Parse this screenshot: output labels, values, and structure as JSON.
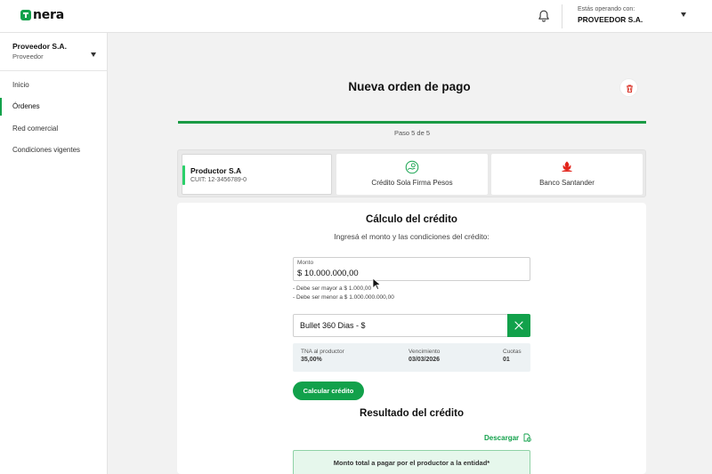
{
  "app": {
    "logo_text": "nera"
  },
  "header": {
    "operating_label": "Estás operando con:",
    "operating_value": "PROVEEDOR S.A."
  },
  "sidebar": {
    "company": "Proveedor S.A.",
    "role": "Proveedor",
    "items": [
      {
        "label": "Inicio",
        "active": false
      },
      {
        "label": "Órdenes",
        "active": true
      },
      {
        "label": "Red comercial",
        "active": false
      },
      {
        "label": "Condiciones vigentes",
        "active": false
      }
    ]
  },
  "page": {
    "title": "Nueva orden de pago",
    "step_text": "Paso 5 de 5",
    "progress_fraction": 1.0
  },
  "summary_cards": {
    "producer": {
      "name": "Productor S.A",
      "cuit": "CUIT: 12-3456789-0"
    },
    "product": {
      "label": "Crédito Sola Firma Pesos",
      "icon": "hand-coin-icon"
    },
    "bank": {
      "label": "Banco Santander",
      "icon": "santander-flame-icon"
    }
  },
  "calculation": {
    "title": "Cálculo del crédito",
    "subtitle": "Ingresá el monto y las condiciones del crédito:",
    "amount_label": "Monto",
    "amount_value": "$ 10.000.000,00",
    "hint_min": "- Debe ser mayor a $ 1.000,00",
    "hint_max": "- Debe ser menor a $ 1.000.000.000,00",
    "plan_value": "Bullet 360 Dias - $",
    "conditions": {
      "tna_label": "TNA al productor",
      "tna_value": "35,00%",
      "due_label": "Vencimiento",
      "due_value": "03/03/2026",
      "installments_label": "Cuotas",
      "installments_value": "01"
    },
    "calculate_button": "Calcular crédito"
  },
  "result": {
    "title": "Resultado del crédito",
    "download_label": "Descargar",
    "total_label": "Monto total a pagar por el productor a la entidad*"
  },
  "colors": {
    "accent": "#12a14b",
    "active_bar": "#2bd06a",
    "danger": "#d93025",
    "santander_red": "#e2231a"
  }
}
